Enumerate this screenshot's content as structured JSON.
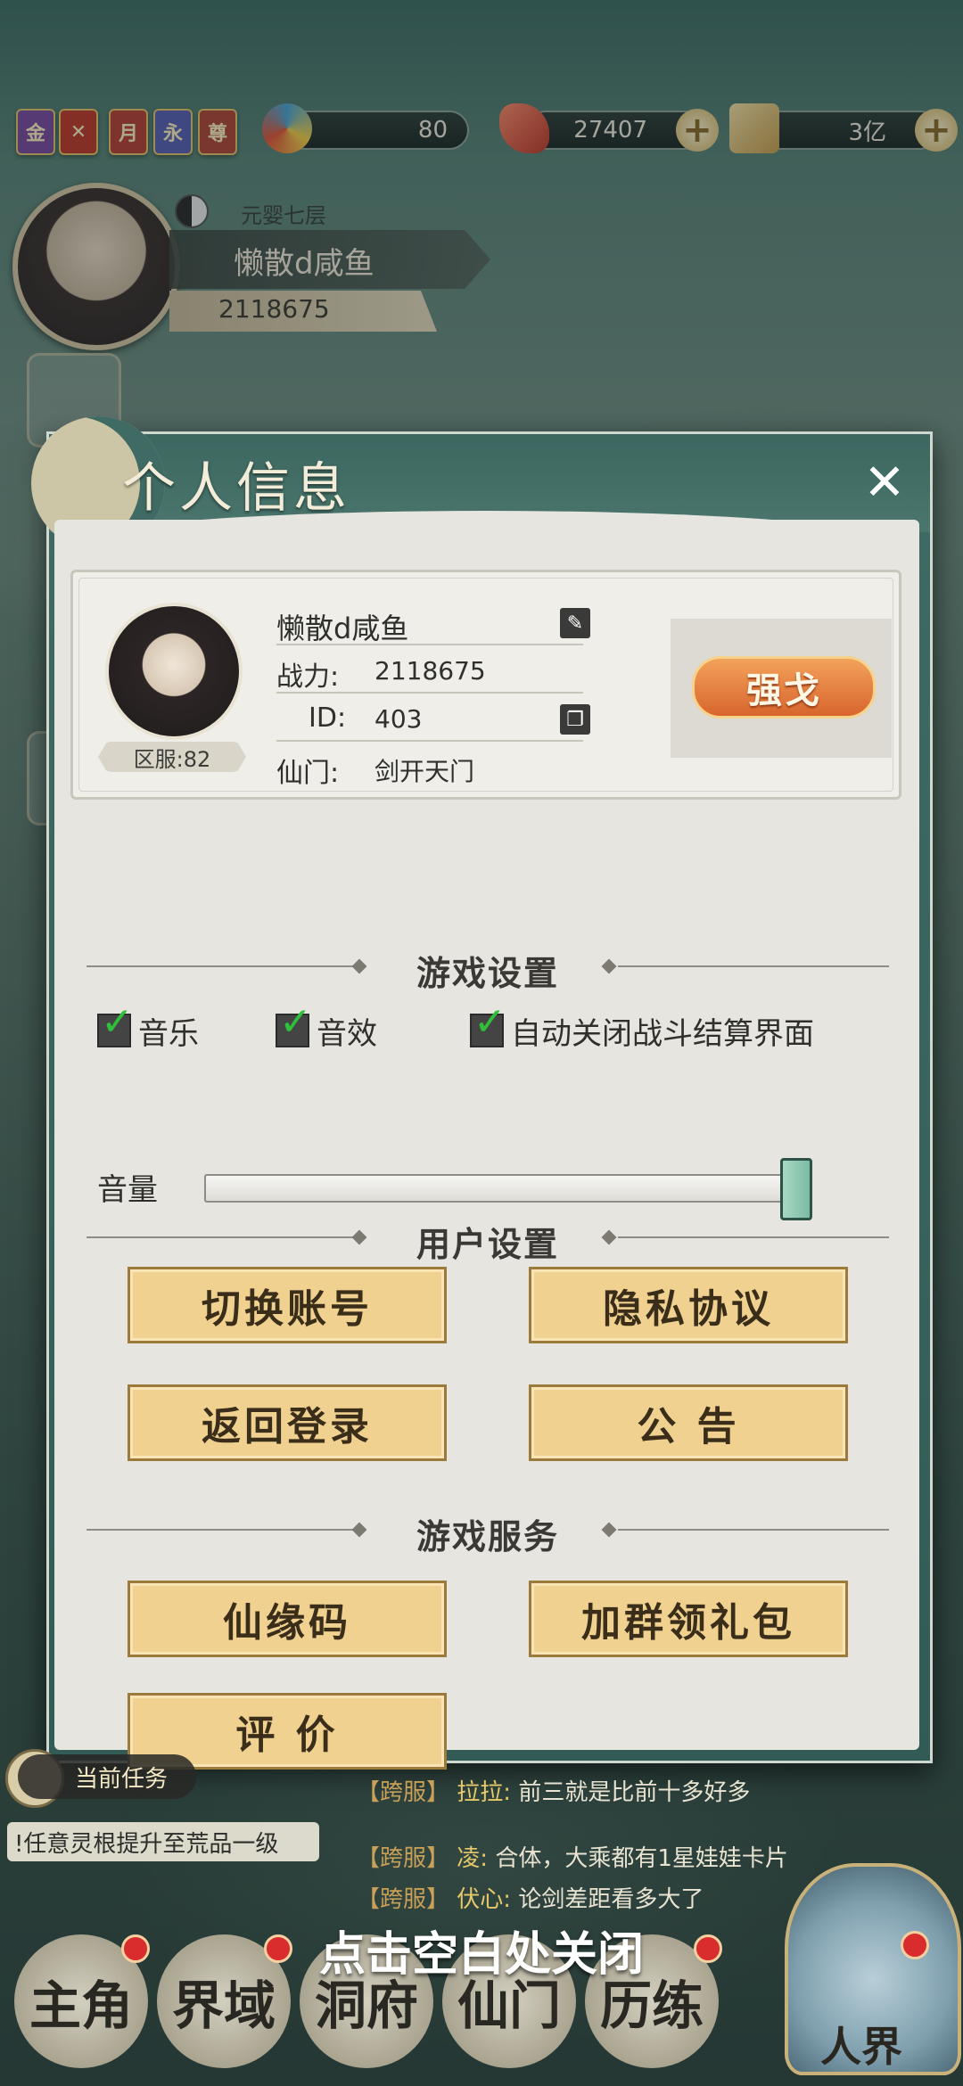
{
  "topbar": {
    "badges": [
      {
        "label": "金",
        "color": "#7a4aa3"
      },
      {
        "label": "✕",
        "color": "#c0392b"
      },
      {
        "label": "月",
        "color": "#b8403a"
      },
      {
        "label": "永",
        "color": "#5860b8"
      },
      {
        "label": "尊",
        "color": "#b0463a"
      }
    ],
    "resources": [
      {
        "name": "spirit-swirl-icon",
        "value": "80"
      },
      {
        "name": "red-crystal-icon",
        "value": "27407"
      },
      {
        "name": "gold-scroll-icon",
        "value": "3亿"
      }
    ]
  },
  "player": {
    "realm": "元婴七层",
    "name": "懒散d咸鱼",
    "power": "2118675"
  },
  "modal": {
    "title": "个人信息",
    "info": {
      "name": "懒散d咸鱼",
      "power_label": "战力:",
      "power_value": "2118675",
      "id_label": "ID:",
      "id_value": "403",
      "sect_label": "仙门:",
      "sect_value": "剑开天门",
      "server": "区服:82",
      "seal": "强戈"
    },
    "game_settings": {
      "heading": "游戏设置",
      "music": "音乐",
      "sfx": "音效",
      "auto_close": "自动关闭战斗结算界面",
      "volume_label": "音量",
      "volume_level": 1.0
    },
    "user_settings": {
      "heading": "用户设置",
      "switch_account": "切换账号",
      "privacy": "隐私协议",
      "back_login": "返回登录",
      "notice": "公 告"
    },
    "game_services": {
      "heading": "游戏服务",
      "xianyuan_code": "仙缘码",
      "join_group": "加群领礼包",
      "rate": "评 价"
    }
  },
  "hud": {
    "task_title": "当前任务",
    "task_text": "!任意灵根提升至荒品一级",
    "chat": [
      {
        "tag": "【跨服】",
        "who": "拉拉:",
        "msg": "前三就是比前十多好多"
      },
      {
        "tag": "【跨服】",
        "who": "凌:",
        "msg": "合体，大乘都有1星娃娃卡片"
      },
      {
        "tag": "【跨服】",
        "who": "伏心:",
        "msg": "论剑差距看多大了"
      }
    ],
    "close_hint": "点击空白处关闭",
    "nav": [
      "主角",
      "界域",
      "洞府",
      "仙门",
      "历练"
    ],
    "realm_button": "人界"
  }
}
